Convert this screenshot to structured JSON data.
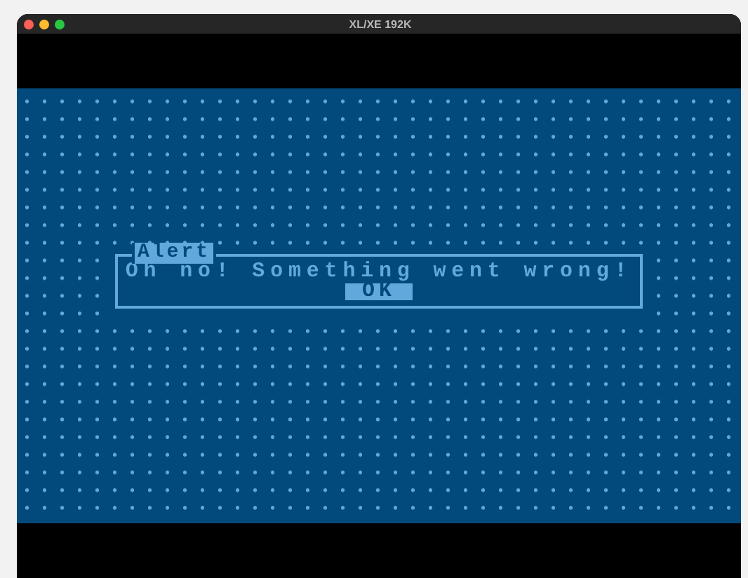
{
  "window": {
    "title": "XL/XE 192K"
  },
  "alert": {
    "title": "Alert",
    "message": "Oh no! Something went wrong!",
    "button": "OK"
  }
}
